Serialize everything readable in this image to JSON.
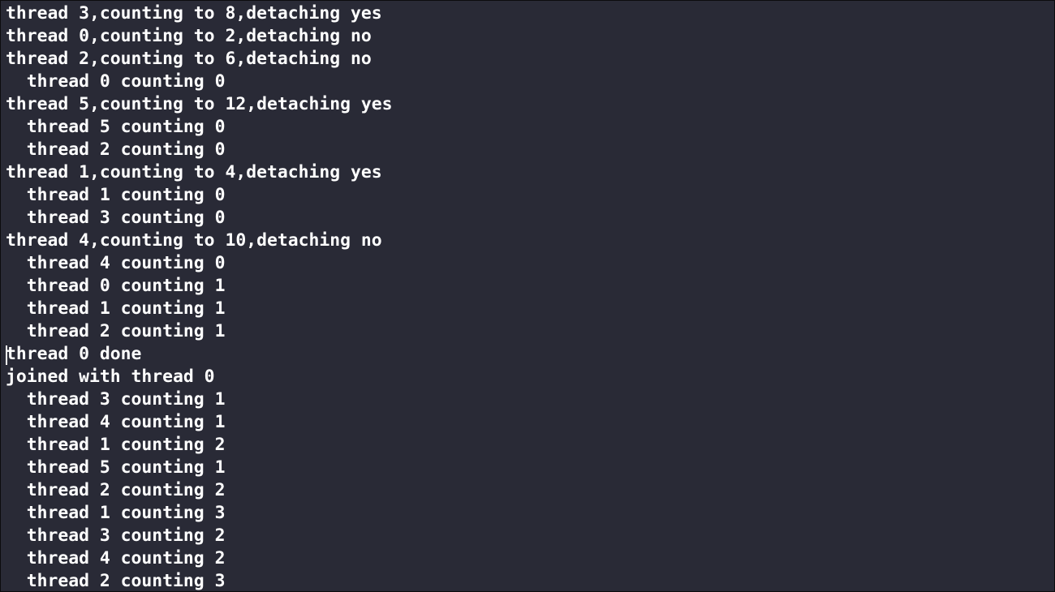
{
  "terminal": {
    "lines": [
      "thread 3,counting to 8,detaching yes",
      "thread 0,counting to 2,detaching no",
      "thread 2,counting to 6,detaching no",
      "  thread 0 counting 0",
      "thread 5,counting to 12,detaching yes",
      "  thread 5 counting 0",
      "  thread 2 counting 0",
      "thread 1,counting to 4,detaching yes",
      "  thread 1 counting 0",
      "  thread 3 counting 0",
      "thread 4,counting to 10,detaching no",
      "  thread 4 counting 0",
      "  thread 0 counting 1",
      "  thread 1 counting 1",
      "  thread 2 counting 1",
      "thread 0 done",
      "joined with thread 0",
      "  thread 3 counting 1",
      "  thread 4 counting 1",
      "  thread 1 counting 2",
      "  thread 5 counting 1",
      "  thread 2 counting 2",
      "  thread 1 counting 3",
      "  thread 3 counting 2",
      "  thread 4 counting 2",
      "  thread 2 counting 3"
    ]
  },
  "colors": {
    "background": "#292a36",
    "text": "#ffffff",
    "frame": "#0c0c0e"
  }
}
